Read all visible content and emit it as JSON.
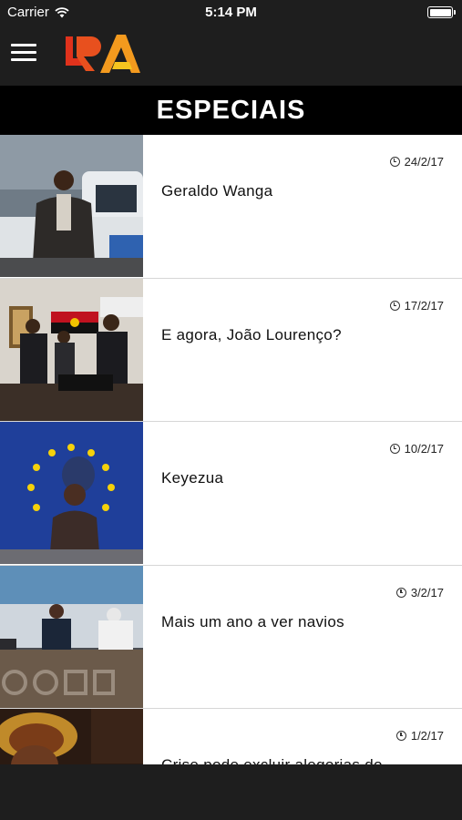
{
  "status_bar": {
    "carrier": "Carrier",
    "time": "5:14 PM"
  },
  "header": {
    "title": "ESPECIAIS",
    "logo_text": "RA"
  },
  "colors": {
    "logo_red": "#e0321c",
    "logo_orange": "#f39a1e",
    "logo_yellow": "#f6c51f",
    "bar_bg": "#1e1e1e"
  },
  "articles": [
    {
      "date": "24/2/17",
      "title": "Geraldo Wanga"
    },
    {
      "date": "17/2/17",
      "title": "E agora, João Lourenço?"
    },
    {
      "date": "10/2/17",
      "title": "Keyezua"
    },
    {
      "date": "3/2/17",
      "title": "Mais um ano a ver navios"
    },
    {
      "date": "1/2/17",
      "title": "Crise pode excluir alegorias do"
    }
  ]
}
